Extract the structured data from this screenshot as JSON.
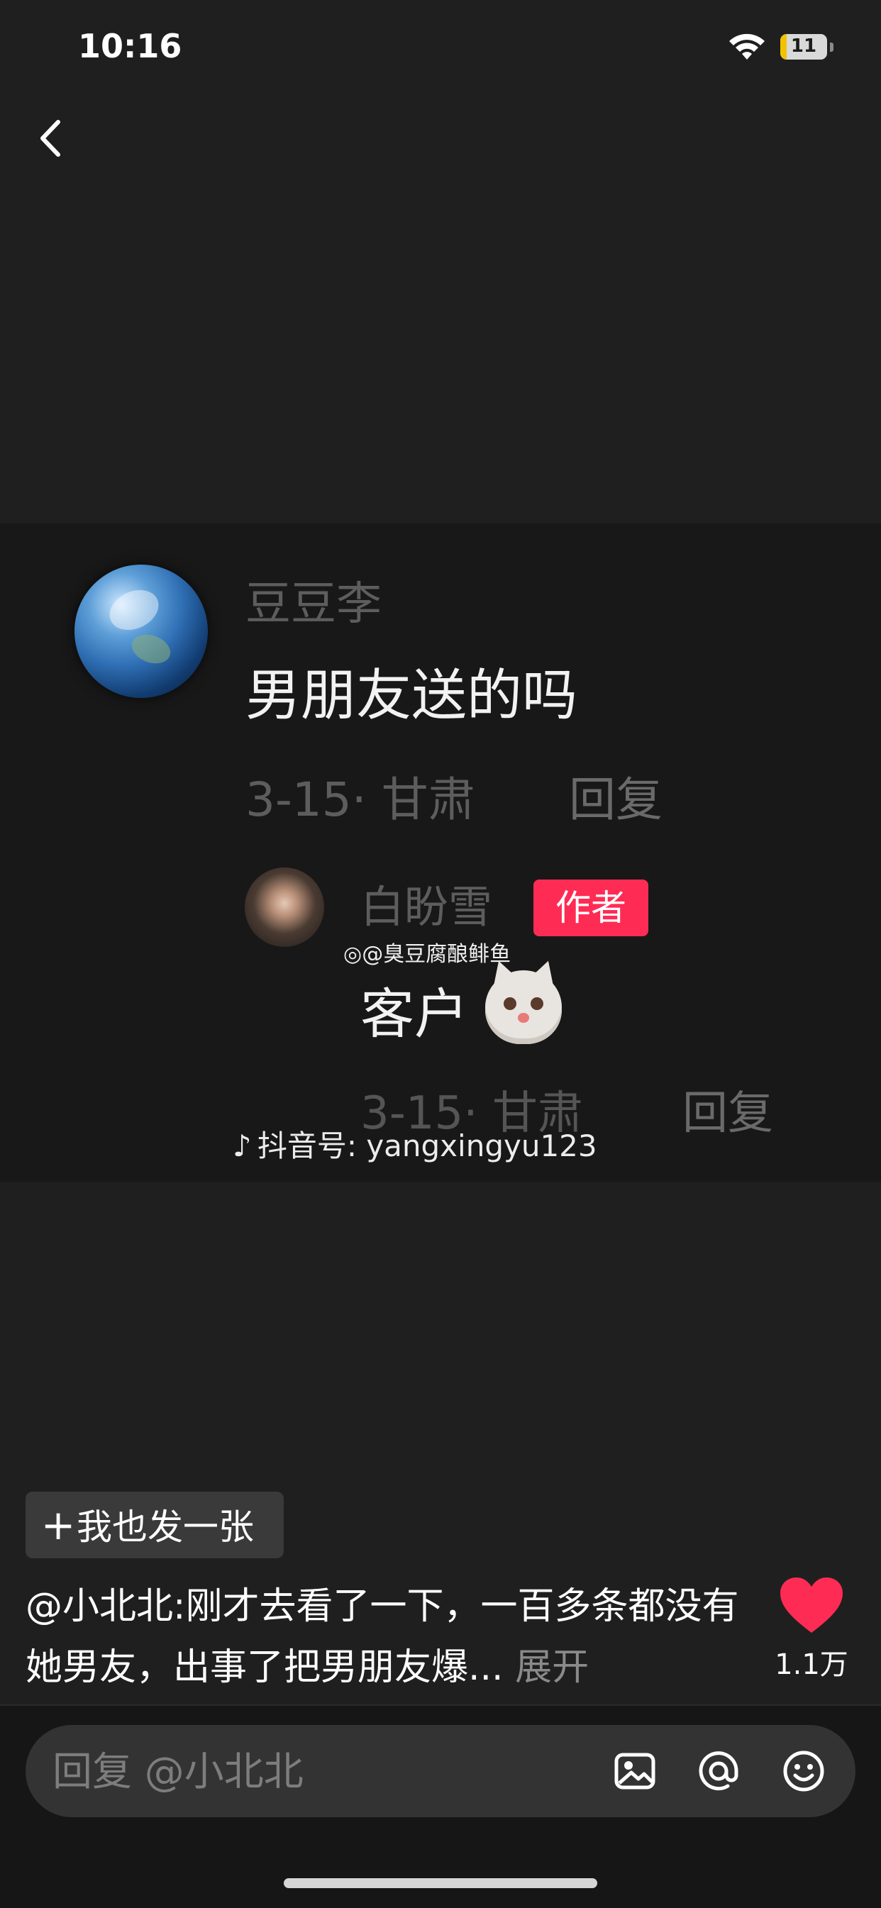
{
  "status_bar": {
    "time": "10:16",
    "battery": "11"
  },
  "image": {
    "comment": {
      "name": "豆豆李",
      "text": "男朋友送的吗",
      "meta": "3-15· 甘肃",
      "reply": "回复"
    },
    "reply": {
      "name": "白盼雪",
      "badge": "作者",
      "text": "客户",
      "meta": "3-15· 甘肃",
      "reply": "回复"
    },
    "watermark_weibo": "@臭豆腐酿鲱鱼",
    "watermark_douyin": "抖音号: yangxingyu123"
  },
  "post_button": {
    "plus": "+",
    "label": "我也发一张"
  },
  "caption": {
    "text": "@小北北:刚才去看了一下，一百多条都没有她男友，出事了把男朋友爆...",
    "expand": "展开"
  },
  "like": {
    "count": "1.1万"
  },
  "reply_bar": {
    "placeholder": "回复 @小北北"
  },
  "icons": {
    "back": "chevron-left-icon",
    "wifi": "wifi-icon",
    "image": "image-icon",
    "at": "at-icon",
    "emoji": "emoji-icon",
    "heart": "heart-icon"
  },
  "colors": {
    "accent": "#fe2c55",
    "background": "#1f1f1f"
  }
}
